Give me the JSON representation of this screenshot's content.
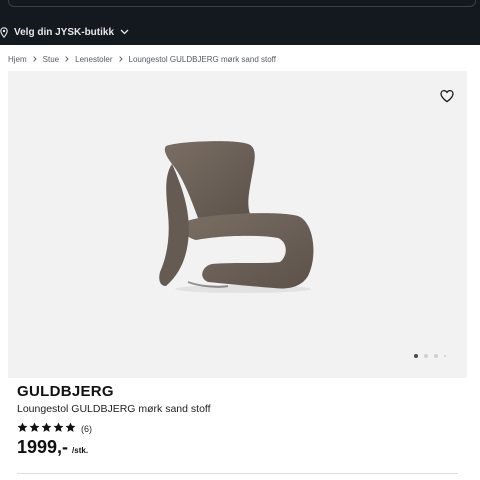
{
  "header": {
    "store_label": "Velg din JYSK-butikk"
  },
  "breadcrumb": {
    "items": [
      "Hjem",
      "Stue",
      "Lenestoler",
      "Loungestol GULDBJERG mørk sand stoff"
    ]
  },
  "gallery": {
    "image_count": 4,
    "active_index": 0,
    "background_color": "#f2f2f2",
    "chair_color": "#6e6258"
  },
  "product": {
    "brand": "GULDBJERG",
    "name": "Loungestol GULDBJERG mørk sand stoff",
    "rating": 5,
    "rating_max": 5,
    "review_count": "(6)",
    "price": "1999,-",
    "price_unit": "/stk."
  },
  "icons": {
    "store": "location-pin-icon",
    "chevron": "chevron-down-icon",
    "breadcrumb_separator": "chevron-right-icon",
    "wishlist": "heart-icon",
    "rating": "star-icon"
  },
  "colors": {
    "header_bg": "#14181f",
    "text": "#1a1a1a"
  }
}
